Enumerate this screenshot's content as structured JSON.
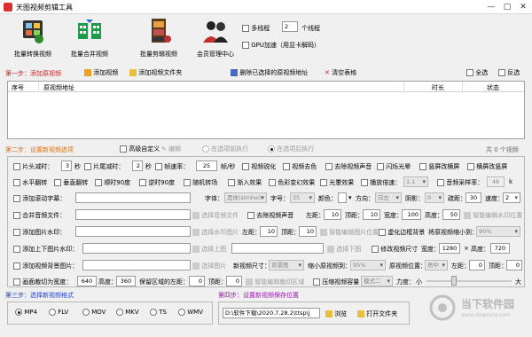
{
  "window": {
    "title": "天图视频剪辑工具"
  },
  "toolbar": [
    {
      "label": "批量转换视频"
    },
    {
      "label": "批量合并视频"
    },
    {
      "label": "批量剪辑视频"
    },
    {
      "label": "会员管理中心"
    }
  ],
  "threads": {
    "label": "多线程",
    "value": "2",
    "unit": "个线程",
    "gpu_label": "GPU加速（用显卡解码）"
  },
  "step1": {
    "title": "第一步：添加原视频",
    "add_video": "添加视频",
    "add_folder": "添加视频文件夹",
    "delete_selected": "删除已选择的原视频地址",
    "clear_table": "清空表格",
    "select_all": "全选",
    "invert": "反选",
    "columns": [
      "序号",
      "原视频地址",
      "时长",
      "状态"
    ]
  },
  "step2": {
    "title": "第二步：设置新视频选项",
    "advanced": "高级自定义",
    "edit": "编辑",
    "in_option_exec": "在选项前执行",
    "after_option_exec": "在选项后执行",
    "count": "共 0 个视频",
    "row1": {
      "head_trim": "片头减时：",
      "head_val": "3",
      "sec1": "秒",
      "tail_trim": "片尾减时：",
      "tail_val": "2",
      "sec2": "秒",
      "fps": "帧速率：",
      "fps_val": "25",
      "fps_unit": "帧/秒",
      "sharpen": "视频锐化",
      "color": "视频去色",
      "remove_audio": "去除视频声音",
      "flash": "闪烁光晕",
      "hcrop": "竖屏改横屏",
      "vcrop": "横屏改竖屏"
    },
    "row2": {
      "hflip": "水平翻转",
      "vflip": "垂直翻转",
      "rot90": "顺时90度",
      "rot90c": "逆时90度",
      "random": "随机转场",
      "fadein": "渐入效果",
      "color_change": "色彩变幻效果",
      "light": "光暈效果",
      "speed": "播放倍速：",
      "speed_val": "1.1",
      "sample": "音频采样率：",
      "sample_val": "48",
      "sample_unit": "k"
    },
    "row3": {
      "add_subtitle": "添加滚动字幕：",
      "font": "字体：",
      "font_val": "黑体(simhei)",
      "size": "字号：",
      "size_val": "35",
      "color": "颜色：",
      "direction": "方向：",
      "direction_val": "向左",
      "shadow": "阴影：",
      "shadow_val": "0",
      "spacing": "疏距：",
      "spacing_val": "30",
      "speed": "速度：",
      "speed_val": "2"
    },
    "row4": {
      "merge_audio": "合并音频文件：",
      "pick_audio": "选择音频文件",
      "remove_audio": "去除视频声音",
      "left": "左距：",
      "left_val": "10",
      "top": "顶距：",
      "top_val": "10",
      "width": "宽度：",
      "width_val": "100",
      "height": "高度：",
      "height_val": "50",
      "smart_watermark": "智能编辑水印位置"
    },
    "row5": {
      "add_watermark": "添加图片水印：",
      "pick_image": "选择水印图片",
      "left": "左距：",
      "left_val": "10",
      "top": "顶距：",
      "top_val": "10",
      "smart": "智能编辑图片位置",
      "blur": "虚化边框背景",
      "scale": "将原视频缩小到：",
      "scale_val": "90%"
    },
    "row6": {
      "add_topbottom": "添加上下图片水印：",
      "pick_top": "选择上图",
      "pick_bottom": "选择下图",
      "resize": "修改视频尺寸",
      "width": "宽度：",
      "width_val": "1280",
      "x": "×",
      "height": "高度：",
      "height_val": "720"
    },
    "row7": {
      "add_bg": "添加视频背景图片：",
      "pick_bg": "选择图片",
      "new_size": "新视频尺寸：",
      "new_size_val": "背景图",
      "shrink": "缩小原视频到：",
      "shrink_val": "95%",
      "position": "原视频位置：",
      "position_val": "居中",
      "left": "左距：",
      "left_val": "0",
      "top": "顶距：",
      "top_val": "0"
    },
    "row8": {
      "crop": "画面裁切为宽度：",
      "width_val": "640",
      "height": "高度：",
      "height_val": "360",
      "keep": "保留区域的左距：",
      "left_val": "0",
      "top": "顶距：",
      "top_val": "0",
      "smart_crop": "智能编辑裁切区域",
      "compress": "压缩视频容量",
      "compress_val": "模式二",
      "strength": "力度：",
      "small": "小",
      "big": "大"
    }
  },
  "step3": {
    "title": "第三步：选择新视频格式",
    "formats": [
      "MP4",
      "FLV",
      "MOV",
      "MKV",
      "TS",
      "WMV"
    ]
  },
  "step4": {
    "title": "第四步：设置新视频保存位置",
    "path": "D:\\软件下载\\2020.7.28.2\\ttsp\\j",
    "browse": "浏览",
    "open_folder": "打开文件夹"
  },
  "watermark": {
    "text": "当下软件园",
    "sub": "www.downxia.com"
  }
}
